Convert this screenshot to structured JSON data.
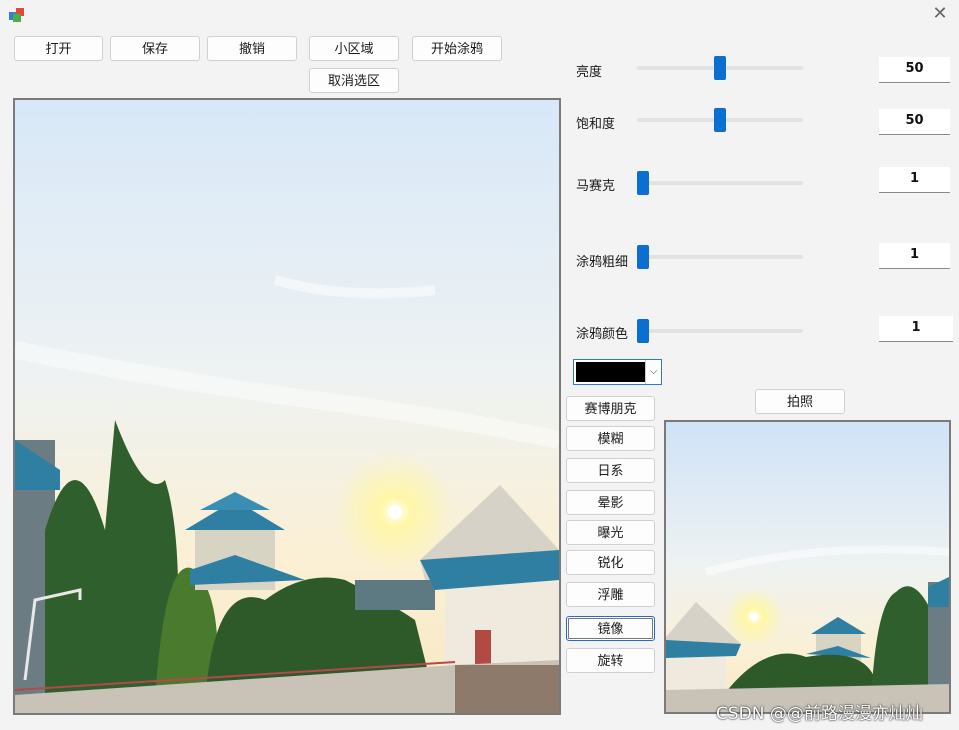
{
  "toolbar": {
    "open": "打开",
    "save": "保存",
    "undo": "撤销",
    "small_region": "小区域",
    "start_doodle": "开始涂鸦",
    "cancel_selection": "取消选区"
  },
  "adjustments": {
    "brightness": {
      "label": "亮度",
      "value": "50",
      "level": 0.5
    },
    "saturation": {
      "label": "饱和度",
      "value": "50",
      "level": 0.5
    },
    "mosaic": {
      "label": "马赛克",
      "value": "1",
      "level": 0
    },
    "brush_size": {
      "label": "涂鸦粗细",
      "value": "1",
      "level": 0
    },
    "brush_color": {
      "label": "涂鸦颜色",
      "value": "1",
      "level": 0
    }
  },
  "color_combo": {
    "selected_color": "#000000"
  },
  "filters": {
    "cyberpunk": "赛博朋克",
    "blur": "模糊",
    "japanese": "日系",
    "vignette": "晕影",
    "exposure": "曝光",
    "sharpen": "锐化",
    "emboss": "浮雕",
    "mirror": "镜像",
    "rotate": "旋转"
  },
  "camera": {
    "photo": "拍照"
  },
  "watermark": "CSDN @@前路漫漫亦灿灿",
  "colors": {
    "accent": "#0a6fd0",
    "sky_top": "#d4e6f8",
    "sun": "#fff6c8",
    "roof": "#2f7fa3"
  }
}
